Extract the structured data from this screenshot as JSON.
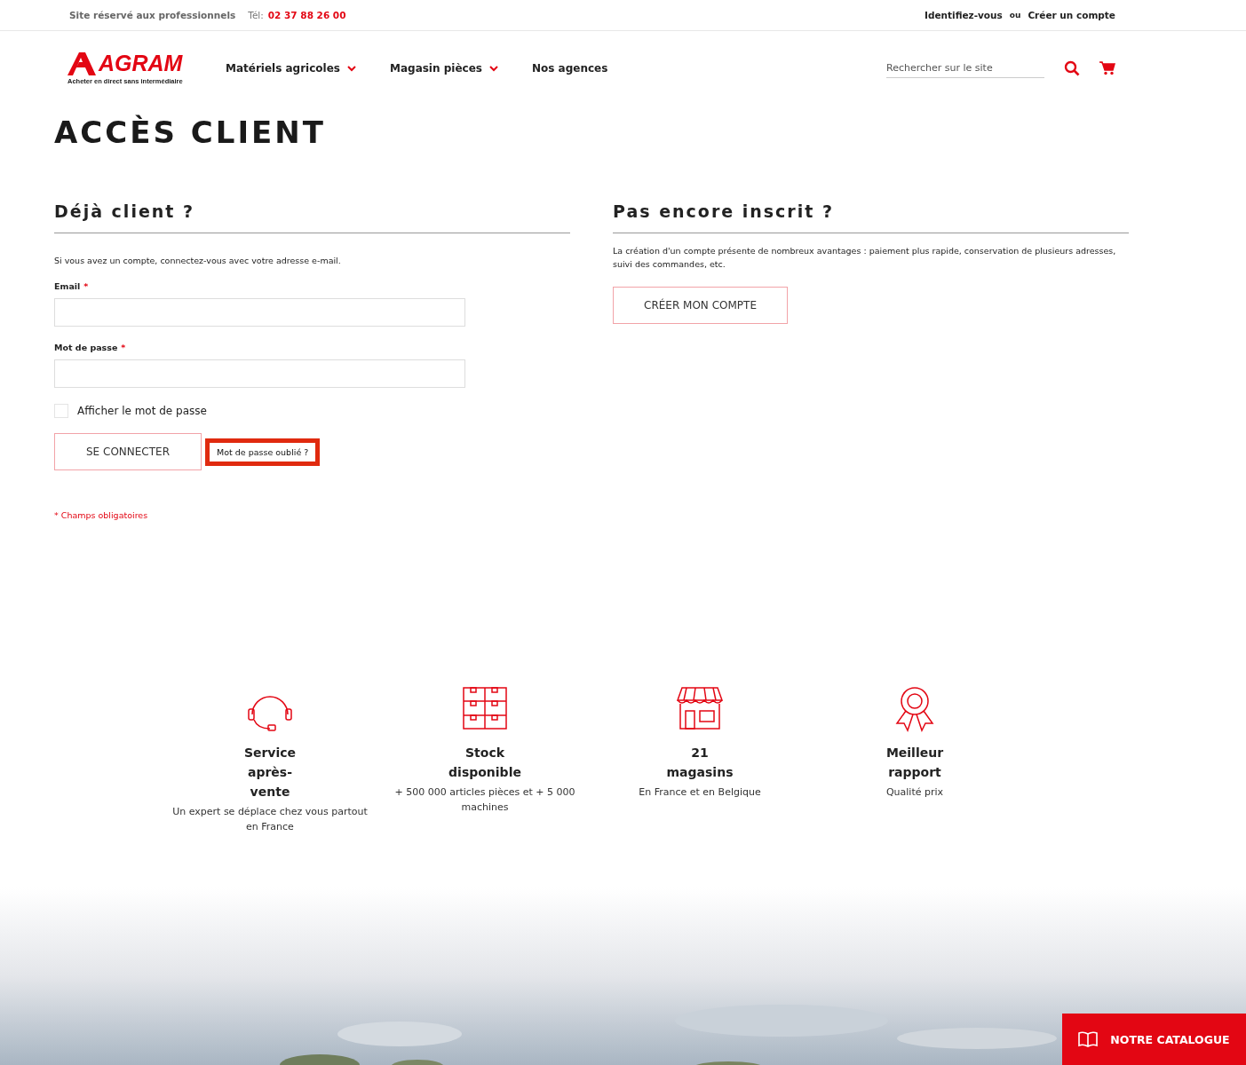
{
  "topbar": {
    "notice": "Site réservé aux professionnels",
    "phone_label": "Tél:",
    "phone": "02 37 88 26 00",
    "login": "Identifiez-vous",
    "separator": "ou",
    "register": "Créer un compte"
  },
  "header": {
    "logo": "AGRAM",
    "tagline": "Acheter en direct sans intermédiaire",
    "nav": [
      {
        "label": "Matériels agricoles",
        "has_dropdown": true
      },
      {
        "label": "Magasin pièces",
        "has_dropdown": true
      },
      {
        "label": "Nos agences",
        "has_dropdown": false
      }
    ],
    "search": {
      "placeholder": "Rechercher sur le site"
    }
  },
  "page_title": "ACCÈS CLIENT",
  "login": {
    "title": "Déjà client ?",
    "intro": "Si vous avez un compte, connectez-vous avec votre adresse e-mail.",
    "fields": [
      {
        "label": "Email",
        "required": "*"
      },
      {
        "label": "Mot de passe",
        "required": "*"
      }
    ],
    "show_password": {
      "label": "Afficher le mot de passe",
      "checked": false
    },
    "submit": "SE CONNECTER",
    "forgot": {
      "label": "Mot de passe oublié ?",
      "highlighted": true
    },
    "required_note": "* Champs obligatoires"
  },
  "register": {
    "title": "Pas encore inscrit ?",
    "text": "La création d'un compte présente de nombreux avantages : paiement plus rapide, conservation de plusieurs adresses, suivi des commandes, etc.",
    "button": "CRÉER MON COMPTE"
  },
  "features": [
    {
      "kind": "headset",
      "title": "Service après-vente",
      "text": "Un expert se déplace chez vous partout en France"
    },
    {
      "kind": "boxes",
      "title": "Stock disponible",
      "text": "+ 500 000 articles pièces et + 5 000 machines"
    },
    {
      "kind": "store",
      "title": "21 magasins",
      "text": "En France et en Belgique"
    },
    {
      "kind": "award",
      "title": "Meilleur rapport",
      "text": "Qualité prix"
    }
  ],
  "catalogue_button": "NOTRE CATALOGUE"
}
